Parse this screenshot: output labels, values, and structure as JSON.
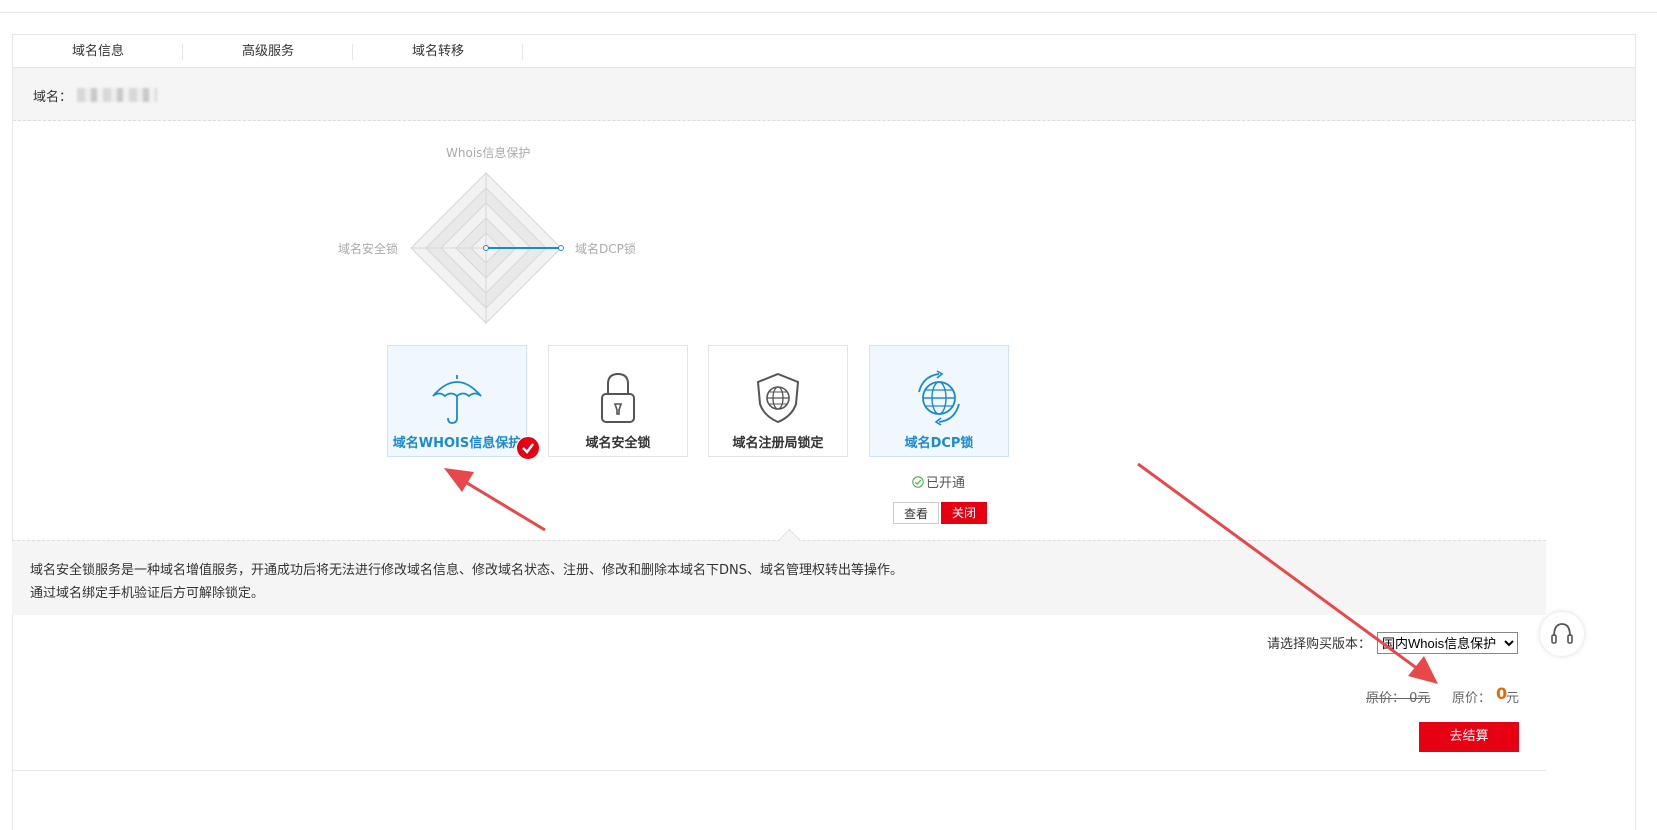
{
  "tabs": [
    "域名信息",
    "高级服务",
    "域名转移"
  ],
  "domain": {
    "label": "域名："
  },
  "radar": {
    "top_label": "Whois信息保护",
    "left_label": "域名安全锁",
    "right_label": "域名DCP锁"
  },
  "services": [
    {
      "label": "域名WHOIS信息保护",
      "icon": "umbrella-icon"
    },
    {
      "label": "域名安全锁",
      "icon": "padlock-icon"
    },
    {
      "label": "域名注册局锁定",
      "icon": "shield-globe-icon"
    },
    {
      "label": "域名DCP锁",
      "icon": "globe-refresh-icon"
    }
  ],
  "dcp_status": {
    "status_text": "已开通",
    "view_label": "查看",
    "close_label": "关闭"
  },
  "description": {
    "line1": "域名安全锁服务是一种域名增值服务，开通成功后将无法进行修改域名信息、修改域名状态、注册、修改和删除本域名下DNS、域名管理权转出等操作。",
    "line2": "通过域名绑定手机验证后方可解除锁定。"
  },
  "purchase": {
    "version_label": "请选择购买版本：",
    "version_selected": "国内Whois信息保护",
    "old_price": "原价：  0元",
    "price_label": "原价：",
    "price_value": "0",
    "price_unit": "元",
    "checkout_label": "去结算"
  },
  "colors": {
    "accent_red": "#e60012",
    "active_blue": "#1a8ad1",
    "price_orange": "#e56b00"
  }
}
